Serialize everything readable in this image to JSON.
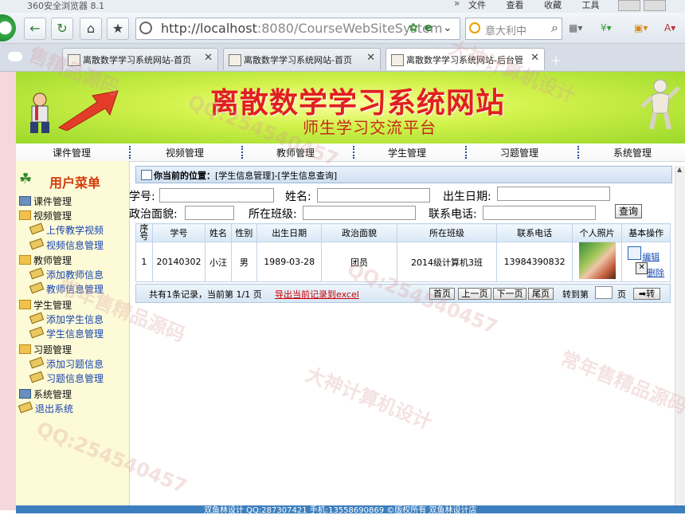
{
  "browser": {
    "title": "360安全浏览器 8.1",
    "menus": [
      "文件",
      "查看",
      "收藏",
      "工具",
      "帮助"
    ],
    "url_host": "http://localhost",
    "url_rest": ":8080/CourseWebSiteSystem",
    "search_placeholder": "意大利中",
    "tabs": [
      {
        "label": "离散数学学习系统网站-首页",
        "active": false
      },
      {
        "label": "离散数学学习系统网站-首页",
        "active": false
      },
      {
        "label": "离散数学学习系统网站-后台管",
        "active": true
      }
    ]
  },
  "banner": {
    "title": "离散数学学习系统网站",
    "subtitle": "师生学习交流平台"
  },
  "topnav": [
    "课件管理",
    "视频管理",
    "教师管理",
    "学生管理",
    "习题管理",
    "系统管理"
  ],
  "sidebar": {
    "header": "用户菜单",
    "groups": [
      {
        "label": "课件管理",
        "items": []
      },
      {
        "label": "视频管理",
        "items": [
          "上传教学视频",
          "视频信息管理"
        ]
      },
      {
        "label": "教师管理",
        "items": [
          "添加教师信息",
          "教师信息管理"
        ]
      },
      {
        "label": "学生管理",
        "items": [
          "添加学生信息",
          "学生信息管理"
        ]
      },
      {
        "label": "习题管理",
        "items": [
          "添加习题信息",
          "习题信息管理"
        ]
      },
      {
        "label": "系统管理",
        "items": []
      }
    ],
    "logout": "退出系统"
  },
  "breadcrumb": {
    "prefix": "你当前的位置：",
    "path": "[学生信息管理]-[学生信息查询]"
  },
  "search_form": {
    "student_no_label": "学号:",
    "name_label": "姓名:",
    "birth_label": "出生日期:",
    "political_label": "政治面貌:",
    "class_label": "所在班级:",
    "phone_label": "联系电话:",
    "query_button": "查询"
  },
  "table": {
    "headers": [
      "序号",
      "学号",
      "姓名",
      "性别",
      "出生日期",
      "政治面貌",
      "所在班级",
      "联系电话",
      "个人照片",
      "基本操作"
    ],
    "rows": [
      {
        "index": "1",
        "student_no": "20140302",
        "name": "小汪",
        "gender": "男",
        "birth": "1989-03-28",
        "political": "团员",
        "class": "2014级计算机3班",
        "phone": "13984390832",
        "edit": "编辑",
        "delete": "删除"
      }
    ]
  },
  "pager": {
    "info": "共有1条记录，当前第 1/1 页",
    "export": "导出当前记录到excel",
    "first": "首页",
    "prev": "上一页",
    "next": "下一页",
    "last": "尾页",
    "goto_label": "转到第",
    "page_unit": "页",
    "go": "➡转"
  },
  "footer": {
    "text": "双鱼林设计 QQ:287307421 手机:13558690869 ©版权所有 双鱼林设计店"
  },
  "watermarks": [
    "售精品源码",
    "大神计算机设计",
    "QQ:254540457",
    "常年售精品源码",
    "QQ:254540457",
    "大神计算机设计",
    "常年售精品源码",
    "QQ:254540457"
  ],
  "colors": {
    "banner_title": "#e0201e",
    "menu_header": "#d43b0b",
    "link": "#1a44b0",
    "footer_bg": "#3c7fbf"
  }
}
